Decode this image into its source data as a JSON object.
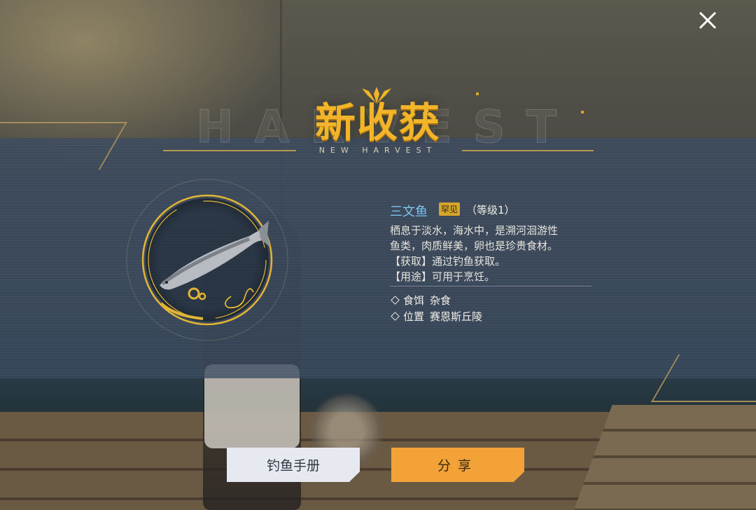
{
  "header": {
    "title": "新收获",
    "subtitle": "NEW HARVEST",
    "background_text": "HARVEST"
  },
  "fish": {
    "name": "三文鱼",
    "rarity": "罕见",
    "level": "（等级1）",
    "description": [
      "栖息于淡水，海水中，是溯河洄游性",
      "鱼类，肉质鲜美，卵也是珍贵食材。",
      "【获取】通过钓鱼获取。",
      "【用途】可用于烹饪。"
    ],
    "attributes": [
      {
        "key": "食饵",
        "value": "杂食"
      },
      {
        "key": "位置",
        "value": "赛恩斯丘陵"
      }
    ]
  },
  "buttons": {
    "manual": "钓鱼手册",
    "share": "分享"
  },
  "icons": {
    "close": "close-icon",
    "fish": "salmon-icon"
  },
  "colors": {
    "accent_gold": "#f2b52a",
    "name_blue": "#7cc4ee",
    "share_orange": "#f2a236"
  }
}
